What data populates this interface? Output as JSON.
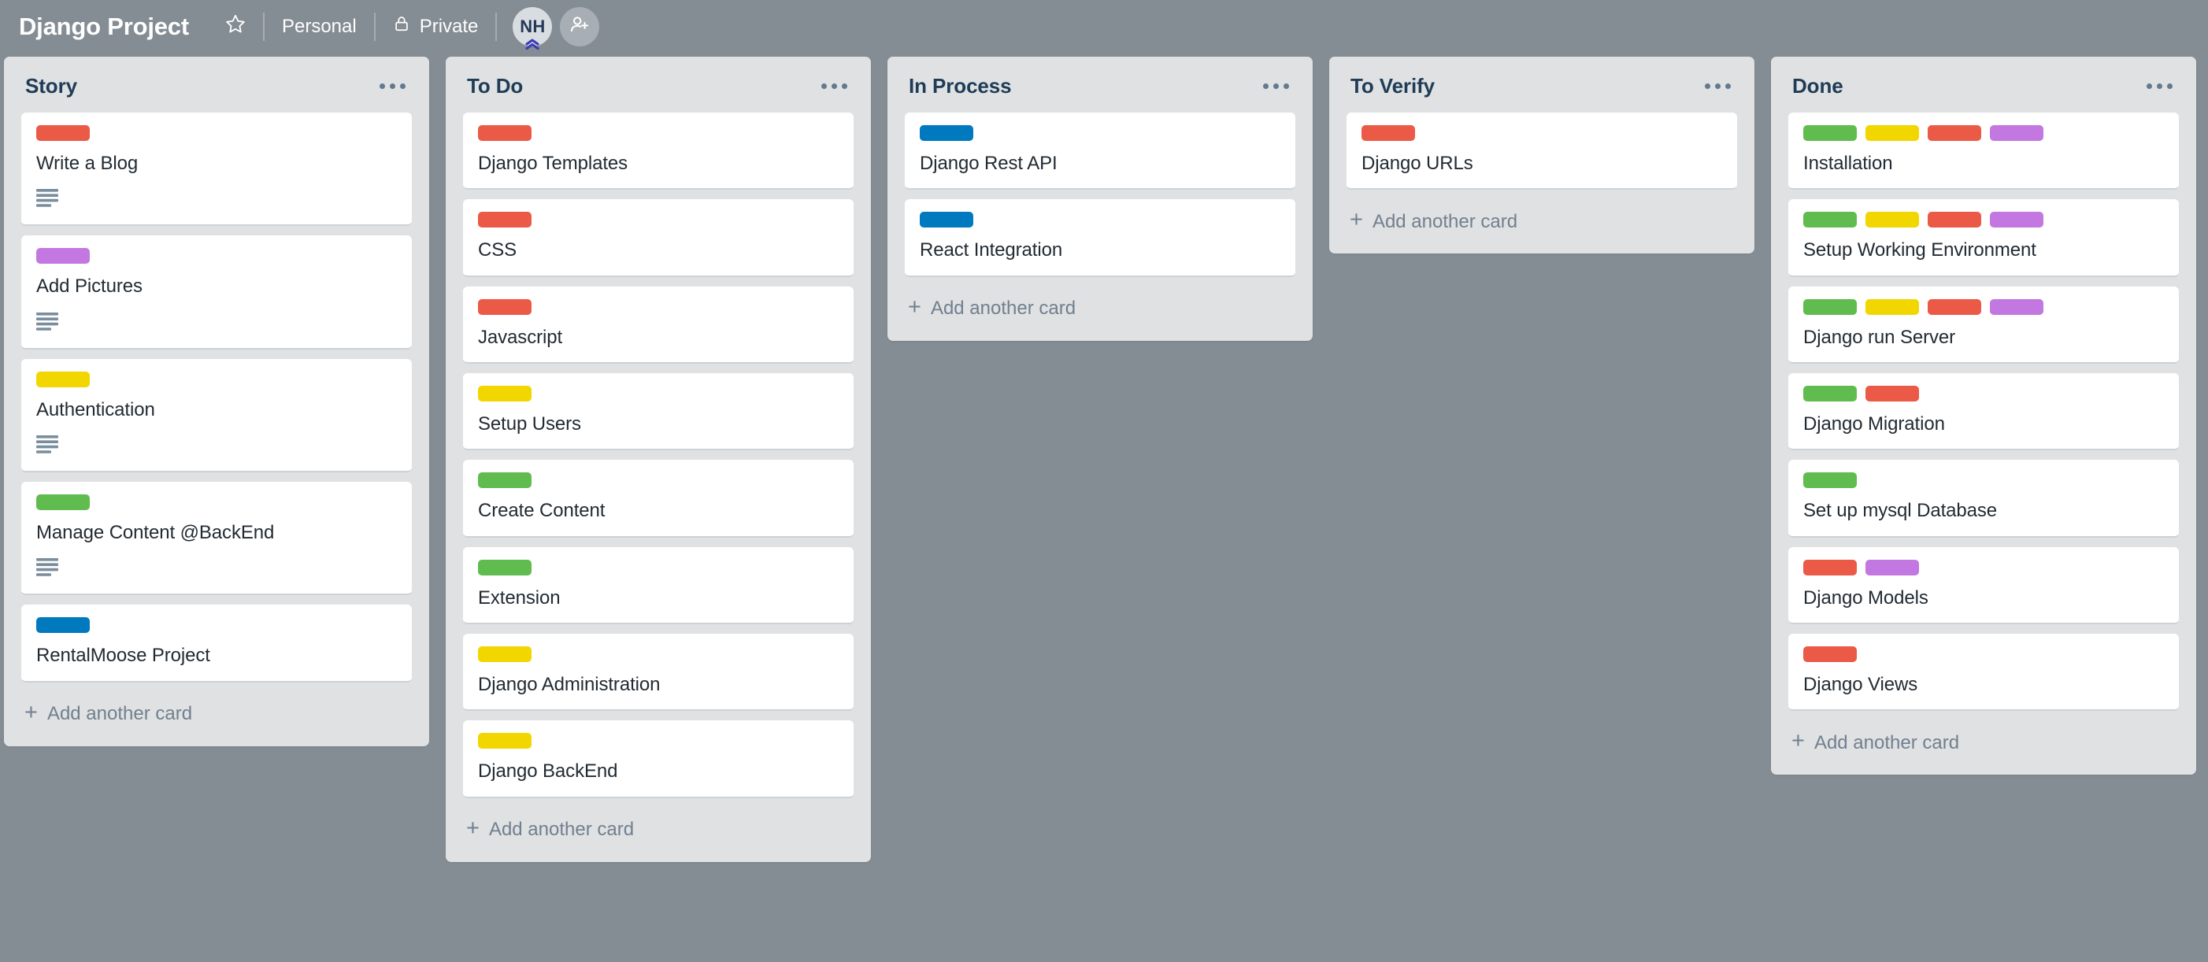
{
  "header": {
    "title": "Django Project",
    "star_icon": "star-icon",
    "visibility_scope": "Personal",
    "privacy_label": "Private",
    "privacy_icon": "lock-icon",
    "avatars": [
      {
        "initials": "NH",
        "type": "member",
        "badge_icon": "chevron-double-up-icon"
      },
      {
        "initials": "",
        "type": "add-member",
        "icon": "add-person-icon"
      }
    ]
  },
  "colors": {
    "board_background": "#848c94",
    "list_background": "#dfe1e3",
    "card_background": "#ffffff",
    "title_text": "#1f3c56",
    "label_green": "#61bc4f",
    "label_yellow": "#f2d600",
    "label_red": "#eb5a46",
    "label_purple": "#c377e0",
    "label_blue": "#0079bf"
  },
  "add_card_label": "Add another card",
  "list_menu_icon": "ellipsis-icon",
  "lists": [
    {
      "title": "Story",
      "cards": [
        {
          "title": "Write a Blog",
          "labels": [
            "red"
          ],
          "has_description": true
        },
        {
          "title": "Add Pictures",
          "labels": [
            "purple"
          ],
          "has_description": true
        },
        {
          "title": "Authentication",
          "labels": [
            "yellow"
          ],
          "has_description": true
        },
        {
          "title": "Manage Content @BackEnd",
          "labels": [
            "green"
          ],
          "has_description": true
        },
        {
          "title": "RentalMoose Project",
          "labels": [
            "blue"
          ],
          "has_description": false
        }
      ]
    },
    {
      "title": "To Do",
      "cards": [
        {
          "title": "Django Templates",
          "labels": [
            "red"
          ],
          "has_description": false
        },
        {
          "title": "CSS",
          "labels": [
            "red"
          ],
          "has_description": false
        },
        {
          "title": "Javascript",
          "labels": [
            "red"
          ],
          "has_description": false
        },
        {
          "title": "Setup Users",
          "labels": [
            "yellow"
          ],
          "has_description": false
        },
        {
          "title": "Create Content",
          "labels": [
            "green"
          ],
          "has_description": false
        },
        {
          "title": "Extension",
          "labels": [
            "green"
          ],
          "has_description": false
        },
        {
          "title": "Django Administration",
          "labels": [
            "yellow"
          ],
          "has_description": false
        },
        {
          "title": "Django BackEnd",
          "labels": [
            "yellow"
          ],
          "has_description": false
        }
      ]
    },
    {
      "title": "In Process",
      "cards": [
        {
          "title": "Django Rest API",
          "labels": [
            "blue"
          ],
          "has_description": false
        },
        {
          "title": "React Integration",
          "labels": [
            "blue"
          ],
          "has_description": false
        }
      ]
    },
    {
      "title": "To Verify",
      "cards": [
        {
          "title": "Django URLs",
          "labels": [
            "red"
          ],
          "has_description": false
        }
      ]
    },
    {
      "title": "Done",
      "cards": [
        {
          "title": "Installation",
          "labels": [
            "green",
            "yellow",
            "red",
            "purple"
          ],
          "has_description": false
        },
        {
          "title": "Setup Working Environment",
          "labels": [
            "green",
            "yellow",
            "red",
            "purple"
          ],
          "has_description": false
        },
        {
          "title": "Django run Server",
          "labels": [
            "green",
            "yellow",
            "red",
            "purple"
          ],
          "has_description": false
        },
        {
          "title": "Django Migration",
          "labels": [
            "green",
            "red"
          ],
          "has_description": false
        },
        {
          "title": "Set up mysql Database",
          "labels": [
            "green"
          ],
          "has_description": false
        },
        {
          "title": "Django Models",
          "labels": [
            "red",
            "purple"
          ],
          "has_description": false
        },
        {
          "title": "Django Views",
          "labels": [
            "red"
          ],
          "has_description": false
        }
      ]
    }
  ]
}
